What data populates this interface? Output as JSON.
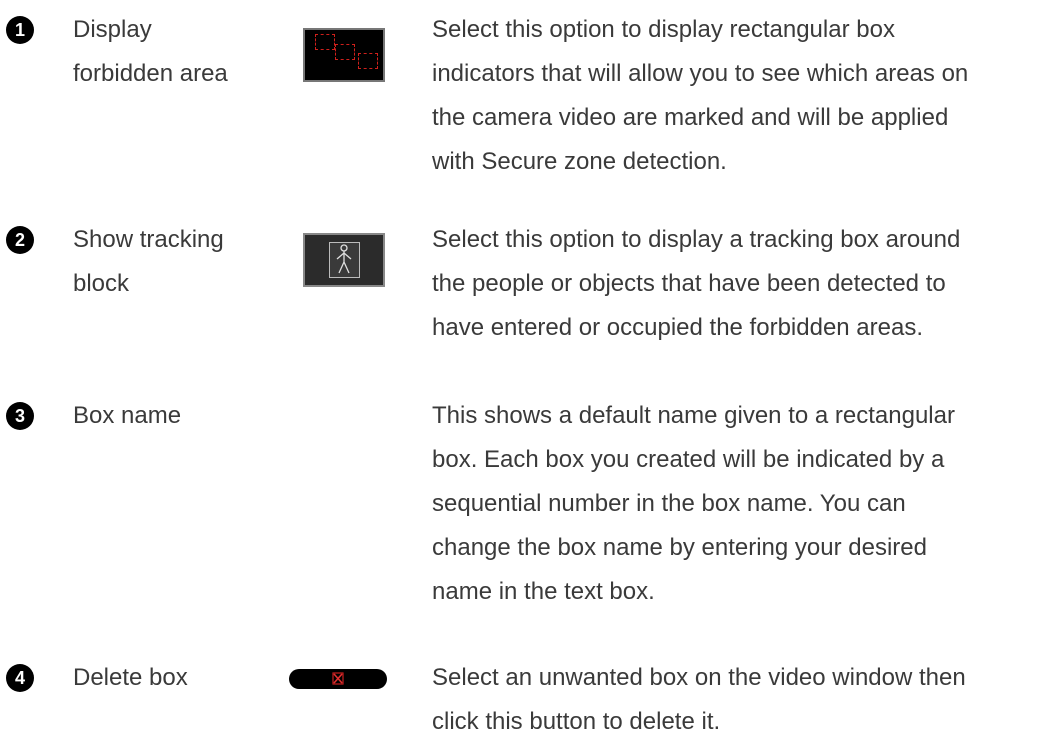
{
  "items": [
    {
      "number": "1",
      "label_lines": [
        "Display",
        "forbidden area"
      ],
      "icon": "forbidden-area-icon",
      "description_lines": [
        "Select this option to display rectangular box",
        "indicators that will allow you to see which areas on",
        "the camera video are marked and will be applied",
        "with Secure zone detection."
      ]
    },
    {
      "number": "2",
      "label_lines": [
        "Show tracking",
        "block"
      ],
      "icon": "tracking-person-icon",
      "description_lines": [
        "Select this option to display a tracking box around",
        "the people or objects that have been detected to",
        "have entered or occupied the forbidden areas."
      ]
    },
    {
      "number": "3",
      "label_lines": [
        "Box name"
      ],
      "icon": "",
      "description_lines": [
        "This shows a default name given to a rectangular",
        "box. Each box you created will be indicated by a",
        "sequential number in the box name. You can",
        "change the box name by entering your desired",
        "name in the text box."
      ]
    },
    {
      "number": "4",
      "label_lines": [
        "Delete box"
      ],
      "icon": "delete-box-button-icon",
      "description_lines": [
        "Select an unwanted box on the video window then",
        "click this button to delete it."
      ]
    }
  ],
  "colors": {
    "text": "#3a3a3a",
    "number_badge": "#000000",
    "forbidden_area_dash": "#d0201b"
  }
}
